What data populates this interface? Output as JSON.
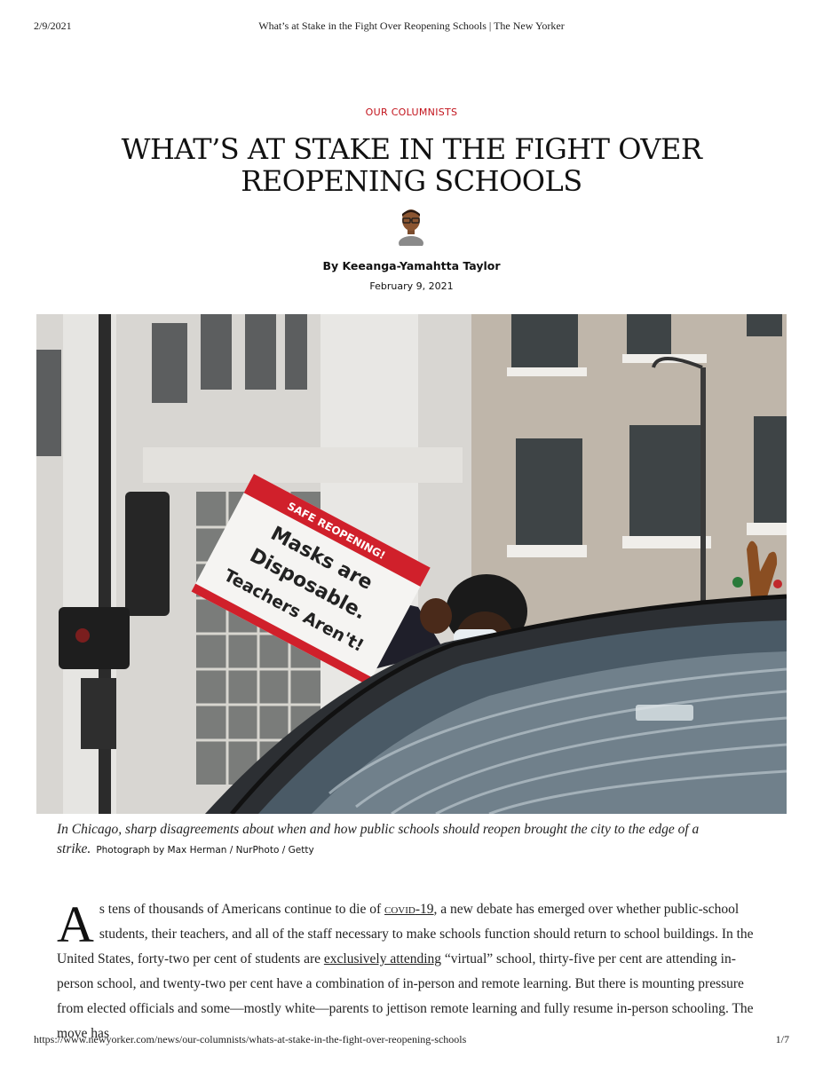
{
  "print_header": {
    "date": "2/9/2021",
    "title": "What’s at Stake in the Fight Over Reopening Schools | The New Yorker"
  },
  "article": {
    "rubric": "OUR COLUMNISTS",
    "headline": "WHAT’S AT STAKE IN THE FIGHT OVER REOPENING SCHOOLS",
    "byline": "By Keeanga-Yamahtta Taylor",
    "date": "February 9, 2021",
    "caption": "In Chicago, sharp disagreements about when and how public schools should reopen brought the city to the edge of a strike.",
    "credit": "Photograph by Max Herman / NurPhoto / Getty",
    "sign_text": [
      "SAFE REOPENING!",
      "Masks are",
      "Disposable.",
      "Teachers Aren't!"
    ],
    "dropcap": "A",
    "p1_a": "s tens of thousands of Americans continue to die of ",
    "p1_link1": "COVID",
    "p1_link1_suffix": "-19",
    "p1_b": ", a new debate has emerged over whether public-school students, their teachers, and all of the staff necessary to make schools function should return to school buildings. In the United States, forty-two per cent of students are ",
    "p1_link2": "exclusively attending",
    "p1_c": " “virtual” school, thirty-five per cent are attending in-person school, and twenty-two per cent have a combination of in-person and remote learning. But there is mounting pressure from elected officials and some—mostly white—parents to jettison remote learning and fully resume in-person schooling. The move has"
  },
  "print_footer": {
    "url": "https://www.newyorker.com/news/our-columnists/whats-at-stake-in-the-fight-over-reopening-schools",
    "page": "1/7"
  },
  "colors": {
    "rubric": "#c2121b",
    "sign_red": "#d0202b"
  }
}
